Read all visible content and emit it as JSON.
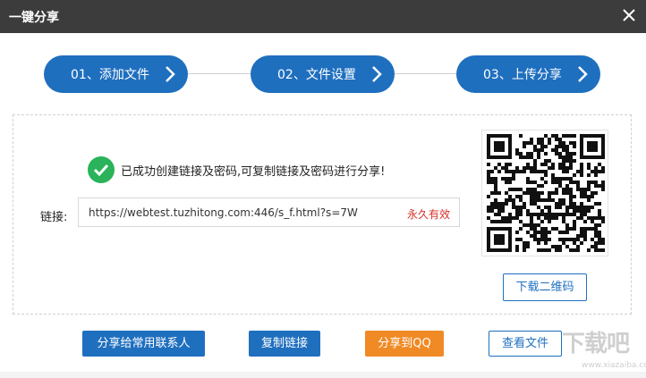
{
  "window": {
    "title": "一键分享"
  },
  "steps": [
    {
      "label": "01、添加文件"
    },
    {
      "label": "02、文件设置"
    },
    {
      "label": "03、上传分享"
    }
  ],
  "result": {
    "message": "已成功创建链接及密码,可复制链接及密码进行分享!",
    "link_label": "链接:",
    "link_url": "https://webtest.tuzhitong.com:446/s_f.html?s=7W",
    "validity": "永久有效"
  },
  "qr": {
    "download_label": "下载二维码"
  },
  "actions": {
    "share_contacts": "分享给常用联系人",
    "copy_link": "复制链接",
    "share_qq": "分享到QQ",
    "view_file": "查看文件"
  },
  "watermark": {
    "text": "下载吧",
    "subtext": "www.xiazaiba.com"
  },
  "colors": {
    "titlebar": "#3c3c3c",
    "primary": "#1f6fbf",
    "accent_orange": "#f08a24",
    "success": "#2ab35a",
    "validity": "#d93025"
  }
}
